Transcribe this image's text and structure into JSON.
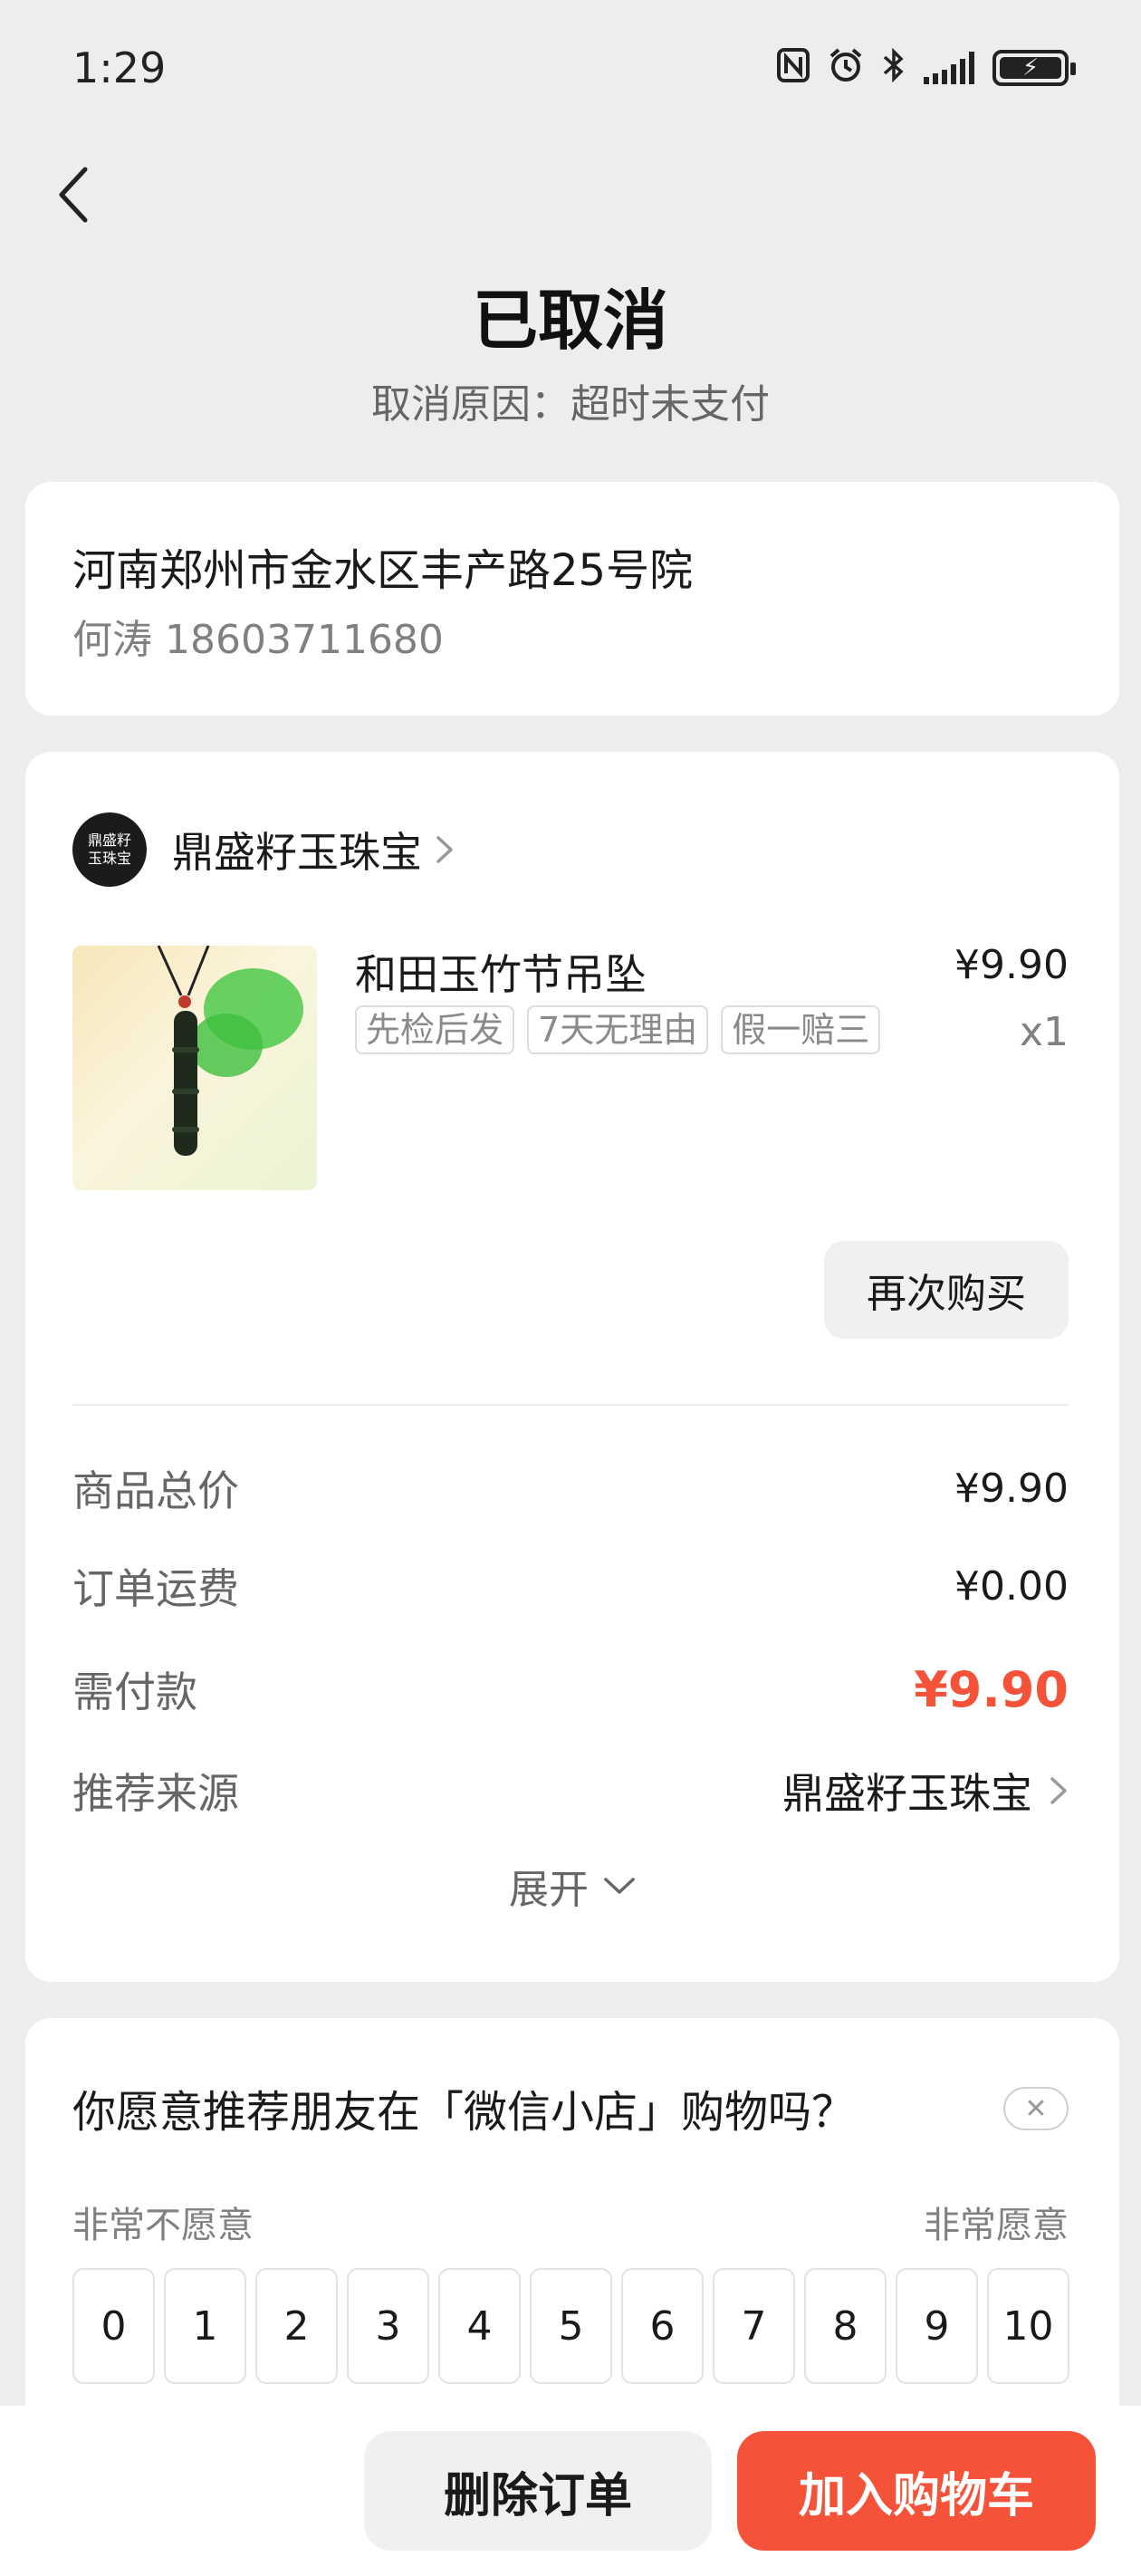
{
  "status_bar": {
    "time": "1:29",
    "icons": [
      "nfc-icon",
      "alarm-icon",
      "bluetooth-icon",
      "signal-icon",
      "battery-charging-icon"
    ]
  },
  "header": {
    "title": "已取消",
    "cancel_reason": "取消原因：超时未支付"
  },
  "address": {
    "line": "河南郑州市金水区丰产路25号院",
    "contact": "何涛 18603711680"
  },
  "order": {
    "shop_logo_text": "鼎盛籽玉珠宝",
    "shop_name": "鼎盛籽玉珠宝",
    "product": {
      "title": "和田玉竹节吊坠",
      "tags": [
        "先检后发",
        "7天无理由",
        "假一赔三"
      ],
      "price": "¥9.90",
      "qty": "x1"
    },
    "rebuy_label": "再次购买",
    "summary": {
      "goods_total_label": "商品总价",
      "goods_total_value": "¥9.90",
      "shipping_label": "订单运费",
      "shipping_value": "¥0.00",
      "payable_label": "需付款",
      "payable_value": "¥9.90",
      "source_label": "推荐来源",
      "source_value": "鼎盛籽玉珠宝"
    },
    "expand_label": "展开"
  },
  "survey": {
    "question": "你愿意推荐朋友在「微信小店」购物吗？",
    "low_label": "非常不愿意",
    "high_label": "非常愿意",
    "scores": [
      "0",
      "1",
      "2",
      "3",
      "4",
      "5",
      "6",
      "7",
      "8",
      "9",
      "10"
    ]
  },
  "bottom_bar": {
    "delete_label": "删除订单",
    "cart_label": "加入购物车"
  },
  "colors": {
    "accent": "#f4533a",
    "background": "#ededed"
  }
}
